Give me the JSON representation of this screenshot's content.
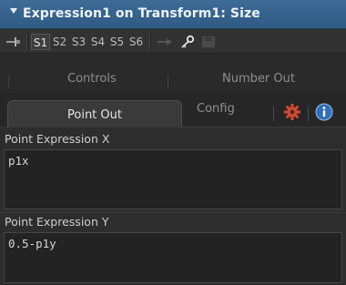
{
  "header": {
    "title": "Expression1 on Transform1: Size"
  },
  "versions": {
    "slots": [
      "S1",
      "S2",
      "S3",
      "S4",
      "S5",
      "S6"
    ],
    "active": "S1"
  },
  "tabs_top": [
    {
      "label": "Controls"
    },
    {
      "label": "Number Out"
    }
  ],
  "tabs_bottom": [
    {
      "label": "Point Out",
      "active": true
    },
    {
      "label": "Config"
    }
  ],
  "fields": {
    "point_x": {
      "label": "Point Expression X",
      "value": "p1x"
    },
    "point_y": {
      "label": "Point Expression Y",
      "value": "0.5-p1y"
    }
  },
  "colors": {
    "titlebar": "#3a6690",
    "accent_gear": "#d04a2e",
    "accent_info": "#2f6fb8"
  },
  "icons": {
    "pin": "pin-icon",
    "link": "link-icon",
    "key": "key-icon",
    "save": "save-icon",
    "gear": "gear-icon",
    "info": "info-icon",
    "collapse": "triangle-down-icon"
  }
}
